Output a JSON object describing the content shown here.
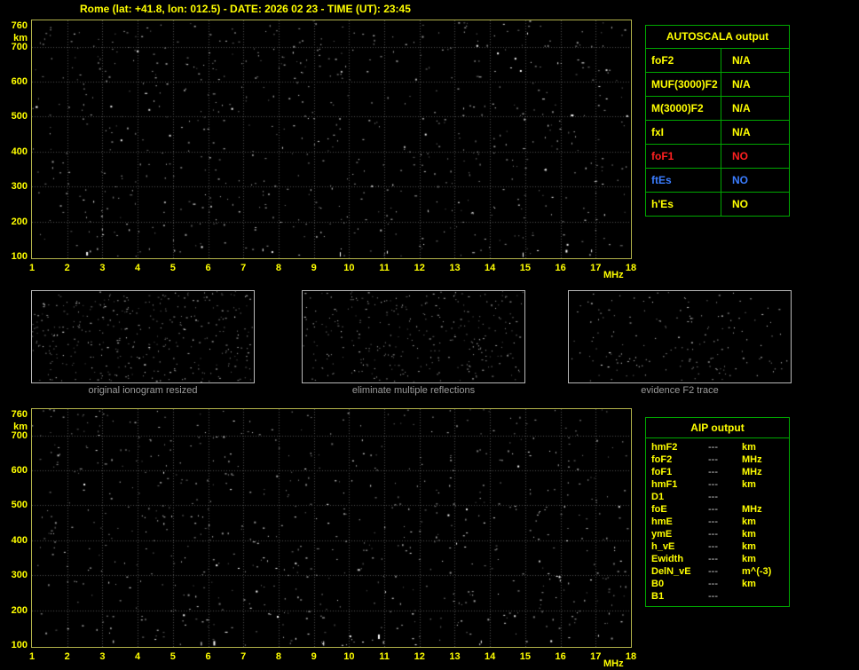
{
  "title": "Rome (lat: +41.8, lon: 012.5) - DATE: 2026 02 23 - TIME (UT): 23:45",
  "colors": {
    "bg": "#000000",
    "accent": "#ffff00",
    "plot_border": "#b2b24a",
    "grid": "#4f4f4f",
    "table_border": "#00a800",
    "caption_gray": "#9c9c9c",
    "value_white": "#cfcfcf",
    "panel_border": "#b8b8b8",
    "red": "#ff2020",
    "blue": "#3b7dff"
  },
  "ionogram": {
    "y_unit": "km",
    "x_unit": "MHz",
    "y_ticks": [
      760,
      700,
      600,
      500,
      400,
      300,
      200,
      100
    ],
    "x_ticks": [
      1,
      2,
      3,
      4,
      5,
      6,
      7,
      8,
      9,
      10,
      11,
      12,
      13,
      14,
      15,
      16,
      17,
      18
    ]
  },
  "autoscala_table": {
    "header": "AUTOSCALA output",
    "rows": [
      {
        "label": "foF2",
        "value": "N/A",
        "color": "#ffff00"
      },
      {
        "label": "MUF(3000)F2",
        "value": "N/A",
        "color": "#ffff00"
      },
      {
        "label": "M(3000)F2",
        "value": "N/A",
        "color": "#ffff00"
      },
      {
        "label": "fxI",
        "value": "N/A",
        "color": "#ffff00"
      },
      {
        "label": "foF1",
        "value": "NO",
        "color": "#ff2020"
      },
      {
        "label": "ftEs",
        "value": "NO",
        "color": "#3b7dff"
      },
      {
        "label": "h'Es",
        "value": "NO",
        "color": "#ffff00"
      }
    ]
  },
  "middle_panels": [
    {
      "caption": "original ionogram resized"
    },
    {
      "caption": "eliminate multiple reflections"
    },
    {
      "caption": "evidence F2 trace"
    }
  ],
  "aip_table": {
    "header": "AIP output",
    "rows": [
      {
        "label": "hmF2",
        "value": "---",
        "unit": "km"
      },
      {
        "label": "foF2",
        "value": "---",
        "unit": "MHz"
      },
      {
        "label": "foF1",
        "value": "---",
        "unit": "MHz"
      },
      {
        "label": "hmF1",
        "value": "---",
        "unit": "km"
      },
      {
        "label": "D1",
        "value": "---",
        "unit": ""
      },
      {
        "label": "foE",
        "value": "---",
        "unit": "MHz"
      },
      {
        "label": "hmE",
        "value": "---",
        "unit": "km"
      },
      {
        "label": "ymE",
        "value": "---",
        "unit": "km"
      },
      {
        "label": "h_vE",
        "value": "---",
        "unit": "km"
      },
      {
        "label": "Ewidth",
        "value": "---",
        "unit": "km"
      },
      {
        "label": "DelN_vE",
        "value": "---",
        "unit": "m^(-3)"
      },
      {
        "label": "B0",
        "value": "---",
        "unit": "km"
      },
      {
        "label": "B1",
        "value": "---",
        "unit": ""
      }
    ]
  },
  "chart_data": [
    {
      "type": "scatter",
      "title": "raw ionogram (top)",
      "xlabel": "MHz",
      "ylabel": "km",
      "xlim": [
        1,
        18
      ],
      "ylim": [
        100,
        760
      ],
      "x_ticks": [
        1,
        2,
        3,
        4,
        5,
        6,
        7,
        8,
        9,
        10,
        11,
        12,
        13,
        14,
        15,
        16,
        17,
        18
      ],
      "y_ticks": [
        100,
        200,
        300,
        400,
        500,
        600,
        700,
        760
      ],
      "grid": true,
      "legend": "none",
      "series": [
        {
          "name": "background noise",
          "description": "uniform random speckle only; no ionospheric echo trace detected (all scaled parameters N/A)"
        }
      ]
    },
    {
      "type": "scatter",
      "title": "processed ionogram (bottom)",
      "xlabel": "MHz",
      "ylabel": "km",
      "xlim": [
        1,
        18
      ],
      "ylim": [
        100,
        760
      ],
      "x_ticks": [
        1,
        2,
        3,
        4,
        5,
        6,
        7,
        8,
        9,
        10,
        11,
        12,
        13,
        14,
        15,
        16,
        17,
        18
      ],
      "y_ticks": [
        100,
        200,
        300,
        400,
        500,
        600,
        700,
        760
      ],
      "grid": true,
      "legend": "none",
      "series": [
        {
          "name": "background noise",
          "description": "uniform random speckle only; no ionospheric echo trace detected"
        }
      ]
    }
  ]
}
